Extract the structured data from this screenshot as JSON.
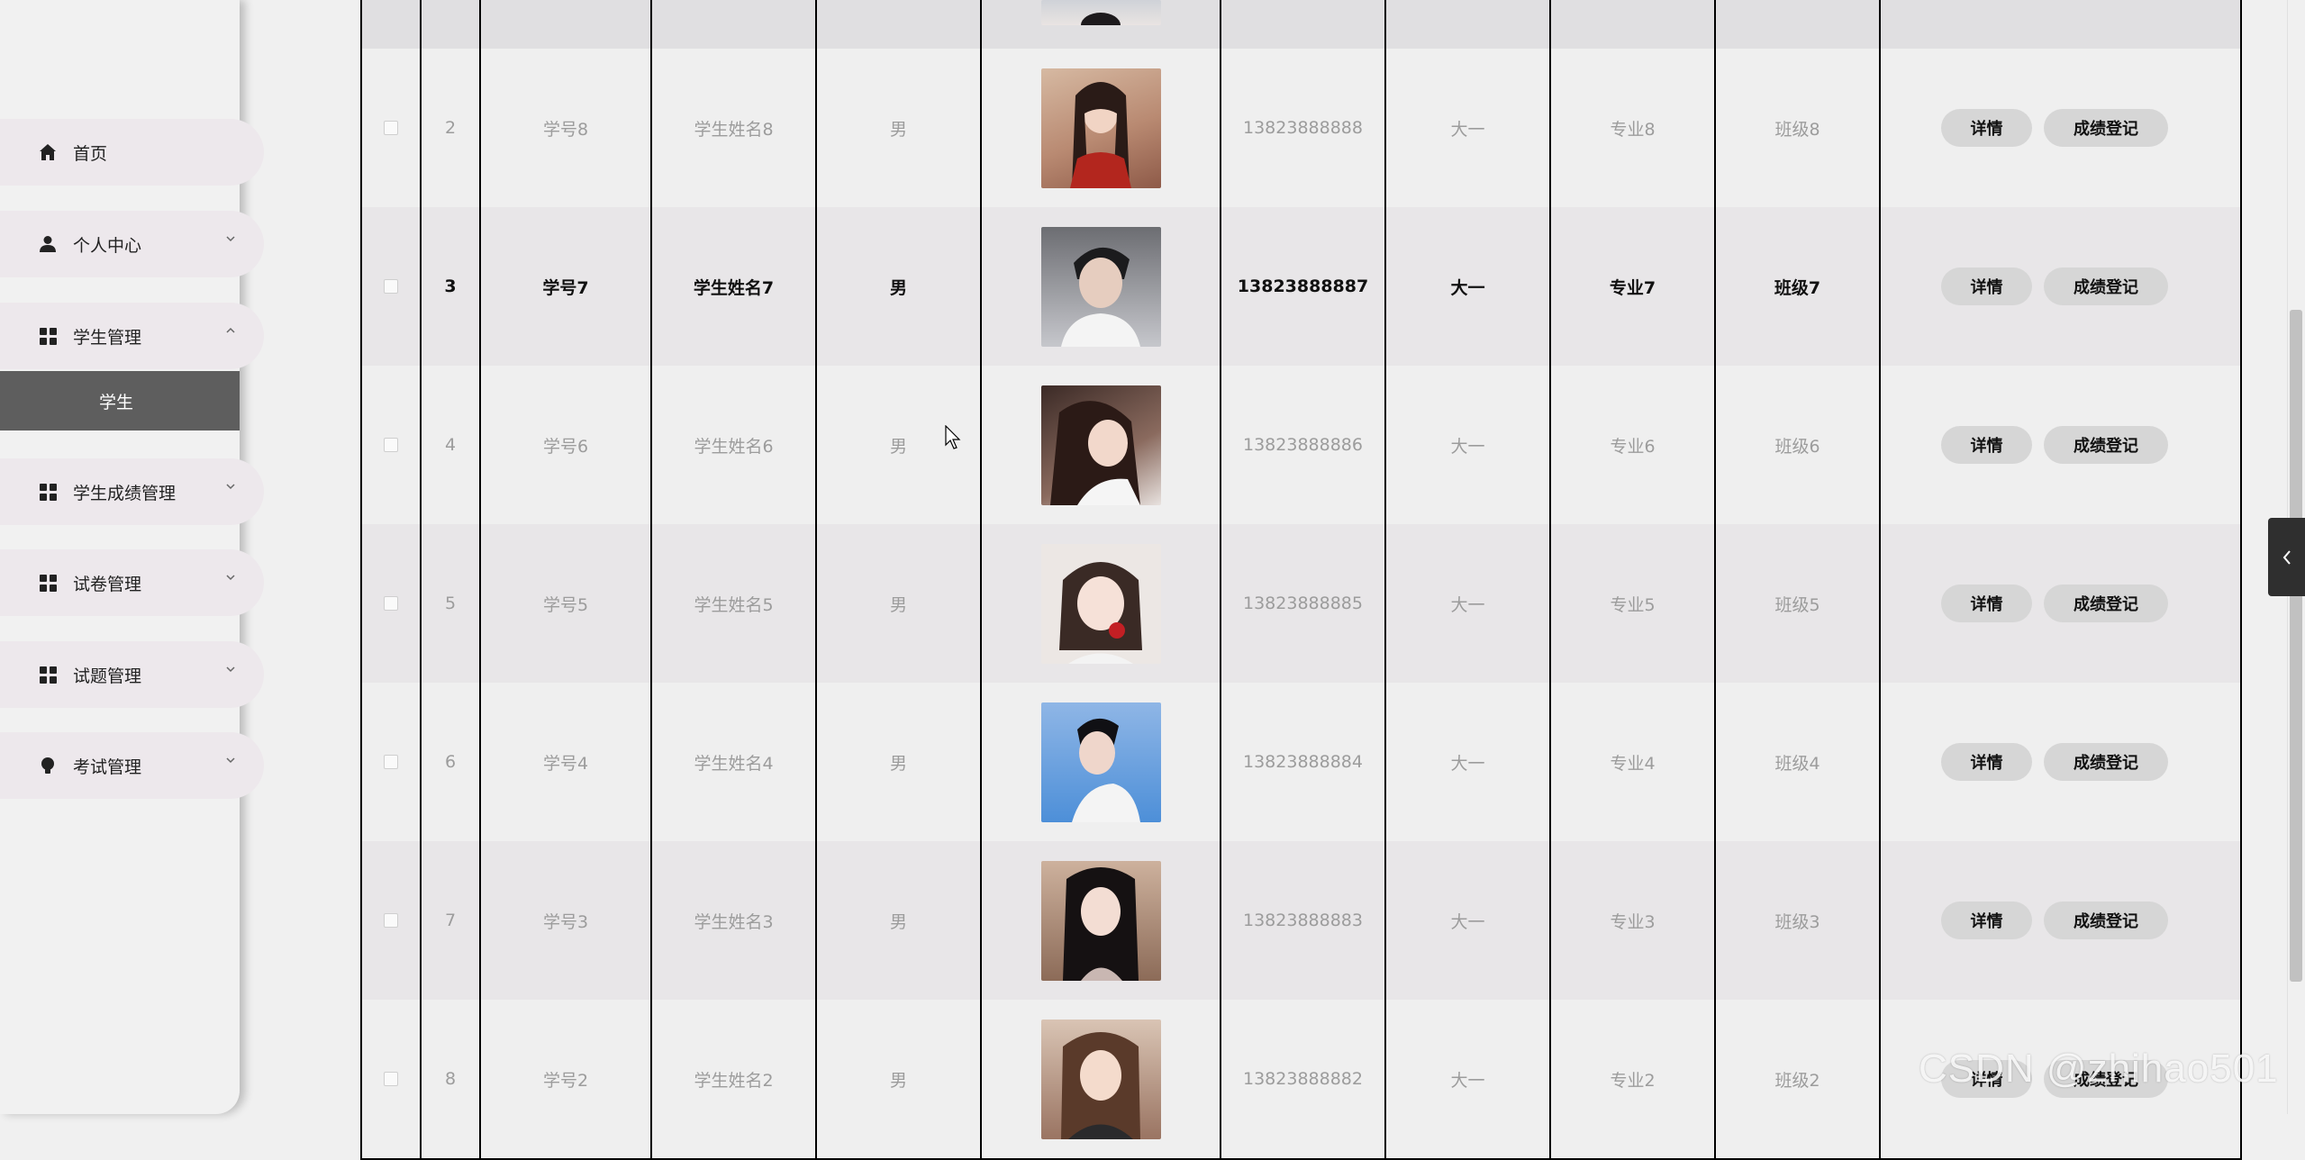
{
  "sidebar": {
    "items": [
      {
        "label": "首页",
        "icon": "home-icon",
        "expandable": false
      },
      {
        "label": "个人中心",
        "icon": "user-icon",
        "expandable": true,
        "expanded": false
      },
      {
        "label": "学生管理",
        "icon": "grid-icon",
        "expandable": true,
        "expanded": true
      },
      {
        "label": "学生成绩管理",
        "icon": "grid-icon",
        "expandable": true,
        "expanded": false
      },
      {
        "label": "试卷管理",
        "icon": "grid-icon",
        "expandable": true,
        "expanded": false
      },
      {
        "label": "试题管理",
        "icon": "grid-icon",
        "expandable": true,
        "expanded": false
      },
      {
        "label": "考试管理",
        "icon": "bulb-icon",
        "expandable": true,
        "expanded": false
      }
    ],
    "submenu": {
      "label": "学生",
      "active": true
    }
  },
  "table": {
    "rows": [
      {
        "index": "2",
        "student_no": "学号8",
        "name": "学生姓名8",
        "sex": "男",
        "phone": "13823888888",
        "grade": "大一",
        "major": "专业8",
        "class": "班级8"
      },
      {
        "index": "3",
        "student_no": "学号7",
        "name": "学生姓名7",
        "sex": "男",
        "phone": "13823888887",
        "grade": "大一",
        "major": "专业7",
        "class": "班级7"
      },
      {
        "index": "4",
        "student_no": "学号6",
        "name": "学生姓名6",
        "sex": "男",
        "phone": "13823888886",
        "grade": "大一",
        "major": "专业6",
        "class": "班级6"
      },
      {
        "index": "5",
        "student_no": "学号5",
        "name": "学生姓名5",
        "sex": "男",
        "phone": "13823888885",
        "grade": "大一",
        "major": "专业5",
        "class": "班级5"
      },
      {
        "index": "6",
        "student_no": "学号4",
        "name": "学生姓名4",
        "sex": "男",
        "phone": "13823888884",
        "grade": "大一",
        "major": "专业4",
        "class": "班级4"
      },
      {
        "index": "7",
        "student_no": "学号3",
        "name": "学生姓名3",
        "sex": "男",
        "phone": "13823888883",
        "grade": "大一",
        "major": "专业3",
        "class": "班级3"
      },
      {
        "index": "8",
        "student_no": "学号2",
        "name": "学生姓名2",
        "sex": "男",
        "phone": "13823888882",
        "grade": "大一",
        "major": "专业2",
        "class": "班级2"
      }
    ],
    "actions": {
      "detail_label": "详情",
      "grade_label": "成绩登记"
    }
  },
  "watermark": "CSDN @zhihao501",
  "colors": {
    "active_submenu": "#5e5e5e",
    "menu_pill": "#ede8ec",
    "button": "#d6d6d6",
    "side_tab": "#2f2f2f"
  }
}
